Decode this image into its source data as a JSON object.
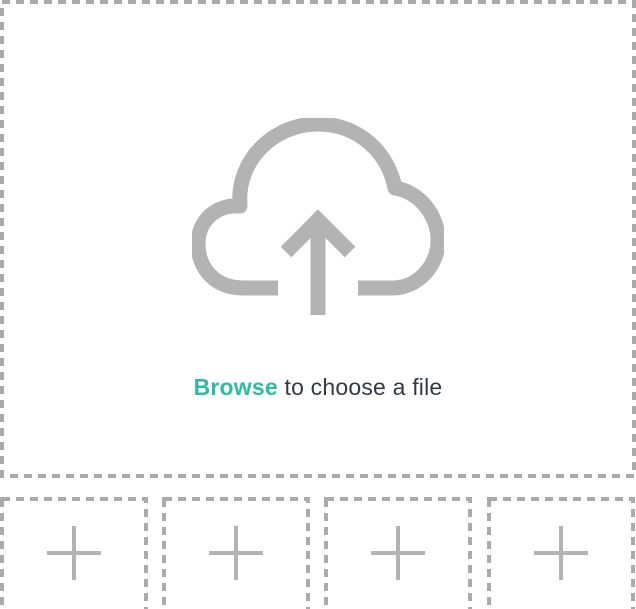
{
  "dropzone": {
    "browse_label": "Browse",
    "instruction": " to choose a file",
    "icon": "cloud-upload-icon"
  },
  "thumbnails": [
    {
      "icon": "plus-icon"
    },
    {
      "icon": "plus-icon"
    },
    {
      "icon": "plus-icon"
    },
    {
      "icon": "plus-icon"
    }
  ],
  "colors": {
    "accent": "#2dbba4",
    "text": "#333a44",
    "border": "#aaaaaa",
    "icon": "#b3b3b3"
  }
}
